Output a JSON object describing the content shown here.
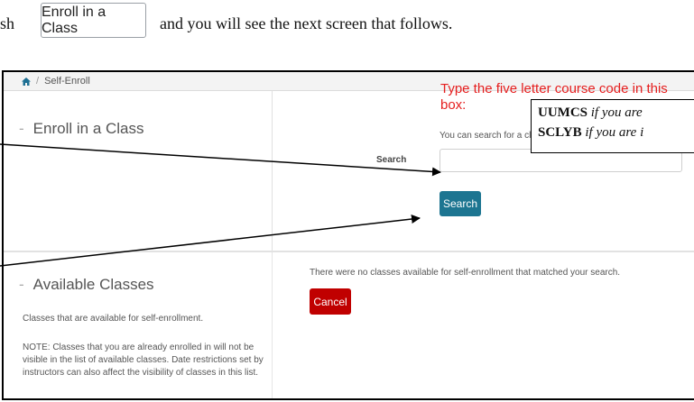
{
  "instruction": {
    "prefix": "sh",
    "button_label": "Enroll in a Class",
    "suffix": "and you will see the next screen that follows."
  },
  "breadcrumb": {
    "home_icon": "home-icon",
    "separator": "/",
    "current": "Self-Enroll"
  },
  "enroll_section": {
    "dash": "-",
    "title": "Enroll in a Class",
    "hint": "You can search for a class using the Class Name.",
    "search_label": "Search",
    "search_value": "",
    "search_button": "Search"
  },
  "callouts": {
    "red_text": "Type the five letter course code in this box:",
    "line1_code": "UUMCS",
    "line1_text": " if you are",
    "line2_code": "SCLYB",
    "line2_text": " if you are i"
  },
  "available_section": {
    "dash": "-",
    "title": "Available Classes",
    "no_results": "There were no classes available for self-enrollment that matched your search.",
    "cancel_button": "Cancel",
    "description": "Classes that are available for self-enrollment.",
    "note": "NOTE: Classes that you are already enrolled in will not be visible in the list of available classes. Date restrictions set by instructors can also affect the visibility of classes in this list."
  },
  "colors": {
    "search_button": "#1d7591",
    "cancel_button": "#c00000",
    "callout_red": "#e51e1e"
  }
}
